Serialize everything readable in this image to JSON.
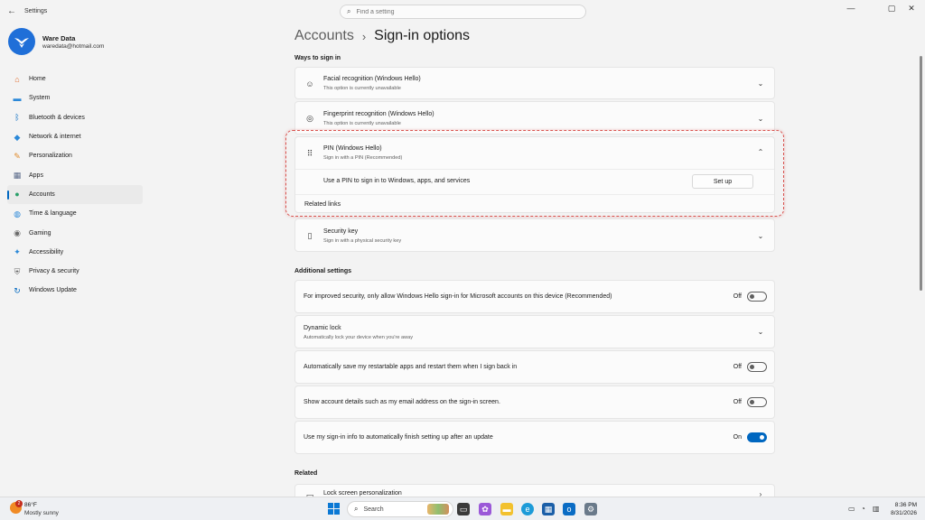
{
  "window": {
    "app_title": "Settings",
    "search_placeholder": "Find a setting",
    "controls": {
      "minimize": "—",
      "maximize": "▢",
      "close": "✕"
    }
  },
  "profile": {
    "name": "Ware Data",
    "email": "waredata@hotmail.com"
  },
  "sidebar": {
    "items": [
      {
        "label": "Home",
        "icon": "home-icon",
        "glyph": "⌂",
        "color": "#e06a2b"
      },
      {
        "label": "System",
        "icon": "monitor-icon",
        "glyph": "▬",
        "color": "#2b88d8"
      },
      {
        "label": "Bluetooth & devices",
        "icon": "bluetooth-icon",
        "glyph": "ᛒ",
        "color": "#0067c0"
      },
      {
        "label": "Network & internet",
        "icon": "wifi-icon",
        "glyph": "◆",
        "color": "#2b88d8"
      },
      {
        "label": "Personalization",
        "icon": "brush-icon",
        "glyph": "✎",
        "color": "#e08a2b"
      },
      {
        "label": "Apps",
        "icon": "apps-icon",
        "glyph": "▦",
        "color": "#5a6a8a"
      },
      {
        "label": "Accounts",
        "icon": "person-icon",
        "glyph": "●",
        "color": "#2aa06a",
        "active": true
      },
      {
        "label": "Time & language",
        "icon": "globe-icon",
        "glyph": "◍",
        "color": "#2b88d8"
      },
      {
        "label": "Gaming",
        "icon": "gamepad-icon",
        "glyph": "◉",
        "color": "#6a6a6a"
      },
      {
        "label": "Accessibility",
        "icon": "accessibility-icon",
        "glyph": "✦",
        "color": "#2b88d8"
      },
      {
        "label": "Privacy & security",
        "icon": "shield-icon",
        "glyph": "⛨",
        "color": "#6a6a6a"
      },
      {
        "label": "Windows Update",
        "icon": "update-icon",
        "glyph": "↻",
        "color": "#0067c0"
      }
    ]
  },
  "main": {
    "breadcrumb_parent": "Accounts",
    "breadcrumb_sep": "›",
    "breadcrumb_current": "Sign-in options",
    "ways_title": "Ways to sign in",
    "facial": {
      "title": "Facial recognition (Windows Hello)",
      "subtitle": "This option is currently unavailable"
    },
    "fingerprint": {
      "title": "Fingerprint recognition (Windows Hello)",
      "subtitle": "This option is currently unavailable"
    },
    "pin": {
      "title": "PIN (Windows Hello)",
      "subtitle": "Sign in with a PIN (Recommended)",
      "detail": "Use a PIN to sign in to Windows, apps, and services",
      "button": "Set up",
      "related_links": "Related links"
    },
    "security_key": {
      "title": "Security key",
      "subtitle": "Sign in with a physical security key"
    },
    "additional_title": "Additional settings",
    "hello_only": {
      "text": "For improved security, only allow Windows Hello sign-in for Microsoft accounts on this device (Recommended)",
      "state": "Off"
    },
    "dynamic_lock": {
      "title": "Dynamic lock",
      "subtitle": "Automatically lock your device when you're away"
    },
    "restart_apps": {
      "text": "Automatically save my restartable apps and restart them when I sign back in",
      "state": "Off"
    },
    "account_details": {
      "text": "Show account details such as my email address on the sign-in screen.",
      "state": "Off"
    },
    "signin_info": {
      "text": "Use my sign-in info to automatically finish setting up after an update",
      "state": "On"
    },
    "related_title": "Related",
    "lock_screen": {
      "title": "Lock screen personalization"
    }
  },
  "taskbar": {
    "weather_temp": "86°F",
    "weather_desc": "Mostly sunny",
    "weather_badge": "2",
    "search_label": "Search",
    "time": "8:36 PM",
    "date": "8/31/2026"
  }
}
